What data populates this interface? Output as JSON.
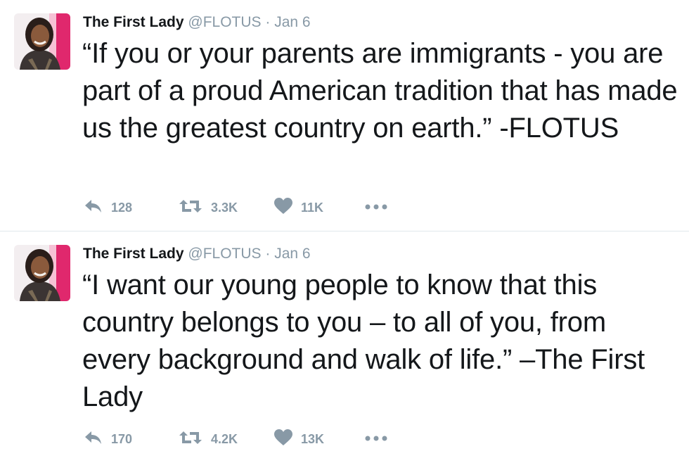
{
  "tweets": [
    {
      "author_name": "The First Lady",
      "handle": "@FLOTUS",
      "separator": "·",
      "date": "Jan 6",
      "text": "“If you or your parents are immigrants - you are part of a proud American tradition that has made us the greatest country on earth.” -FLOTUS",
      "reply_count": "128",
      "retweet_count": "3.3K",
      "like_count": "11K"
    },
    {
      "author_name": "The First Lady",
      "handle": "@FLOTUS",
      "separator": "·",
      "date": "Jan 6",
      "text": "“I want our young people to know that this country belongs to you – to all of you, from every background and walk of life.” –The First Lady",
      "reply_count": "170",
      "retweet_count": "4.2K",
      "like_count": "13K"
    }
  ],
  "icons": {
    "reply": "reply-icon",
    "retweet": "retweet-icon",
    "like": "heart-icon",
    "more": "more-dots-icon"
  },
  "colors": {
    "text": "#14171a",
    "muted": "#8899a6",
    "divider": "#e1e8ed",
    "avatar_accent": "#e0286d"
  }
}
